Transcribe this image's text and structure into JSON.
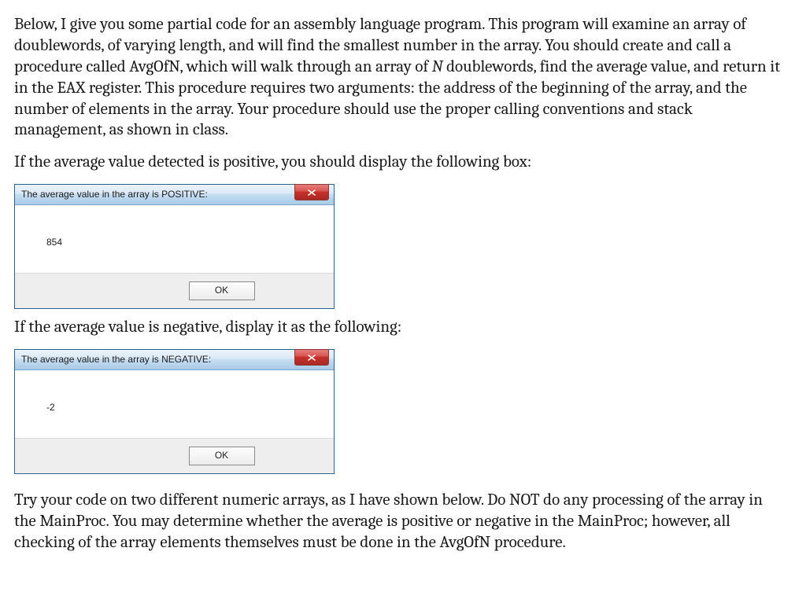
{
  "paragraphs": {
    "intro_before_italic": "Below, I give you some partial code for an assembly language program.  This program will examine an array of doublewords, of varying length, and will find the smallest number in the array.  You should create and call a procedure called AvgOfN, which will walk through an array of ",
    "intro_italic": "N",
    "intro_after_italic": " doublewords, find the average value, and return it in the EAX register.  This procedure requires two arguments: the address of the beginning of the array, and the number of elements in the array.  Your procedure should use the proper calling conventions and stack management, as shown in class.",
    "positive_lead": "If the average value detected is positive, you should display the following box:",
    "negative_lead": "If the average value is negative, display it as the following:",
    "closing": "Try your code on two different numeric arrays, as I have shown below.  Do NOT do any processing of the array in the MainProc.   You may determine whether the average is positive or negative in the MainProc; however, all checking of the array elements themselves must be done in the AvgOfN procedure."
  },
  "dialog_positive": {
    "title": "The average value in the array is POSITIVE:",
    "value": "854",
    "ok": "OK"
  },
  "dialog_negative": {
    "title": "The average value in the array is NEGATIVE:",
    "value": "-2",
    "ok": "OK"
  }
}
